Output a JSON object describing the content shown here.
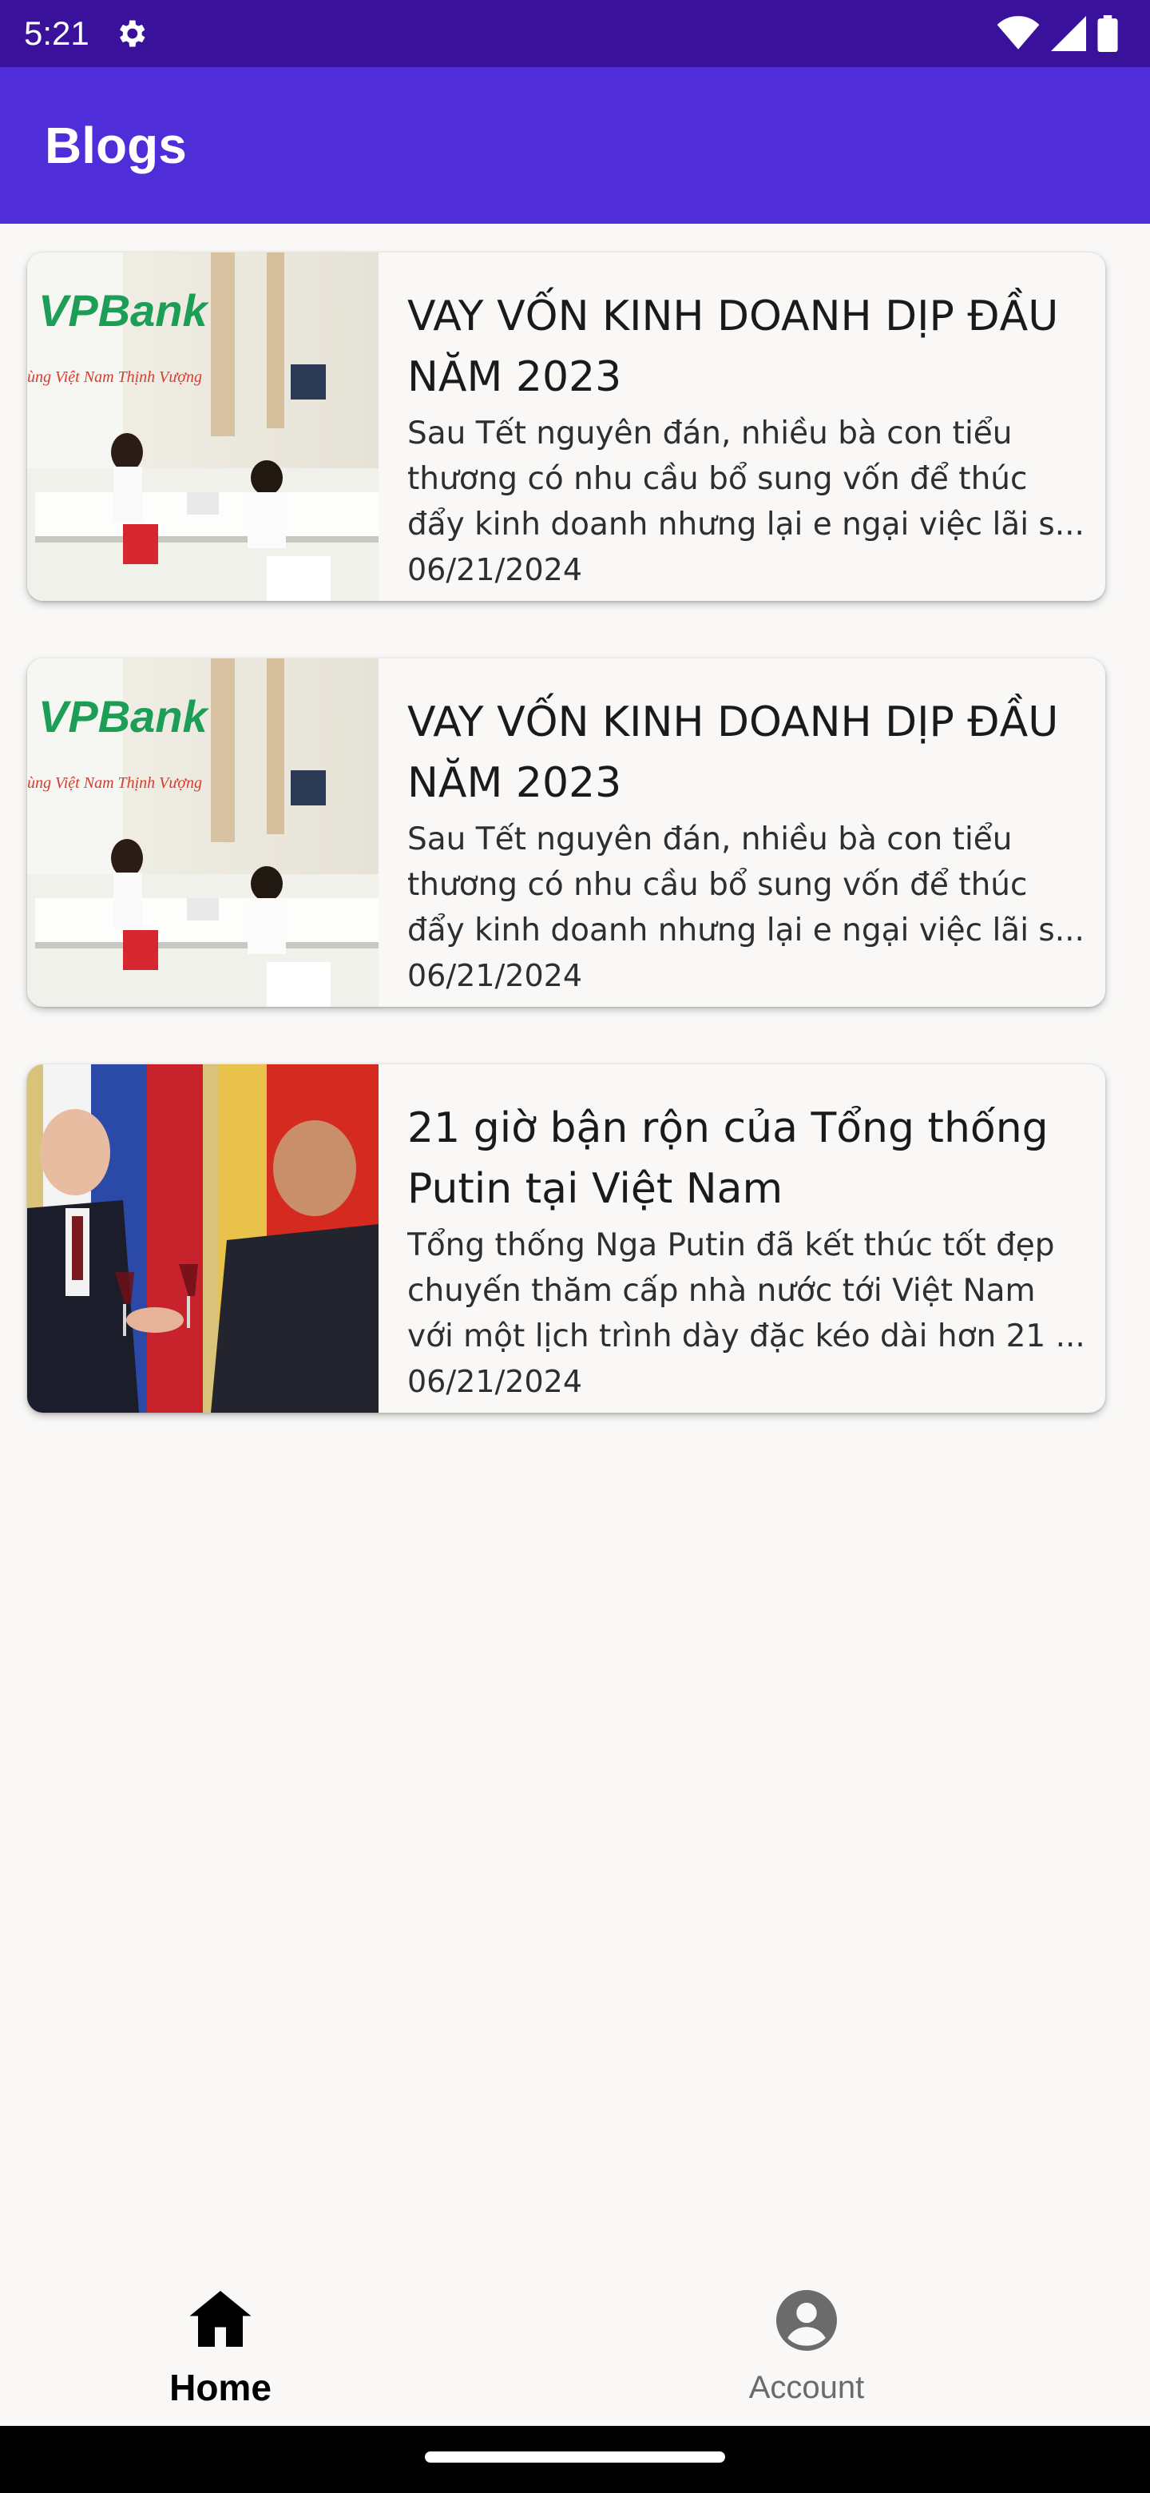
{
  "status_bar": {
    "time": "5:21",
    "icons": [
      "gear-icon",
      "wifi-icon",
      "signal-icon",
      "battery-icon"
    ]
  },
  "app_bar": {
    "title": "Blogs",
    "color": "#4f2dd9"
  },
  "blogs": [
    {
      "title": "VAY VỐN KINH DOANH DỊP ĐẦU NĂM 2023",
      "description": "Sau Tết nguyên đán, nhiều bà con tiểu thương có nhu cầu bổ sung vốn để thúc đẩy kinh doanh nhưng lại e ngại việc lãi s...",
      "date": "06/21/2024",
      "image": "vpbank-branch-photo"
    },
    {
      "title": "VAY VỐN KINH DOANH DỊP ĐẦU NĂM 2023",
      "description": "Sau Tết nguyên đán, nhiều bà con tiểu thương có nhu cầu bổ sung vốn để thúc đẩy kinh doanh nhưng lại e ngại việc lãi s...",
      "date": "06/21/2024",
      "image": "vpbank-branch-photo"
    },
    {
      "title": "21 giờ bận rộn của Tổng thống Putin tại Việt Nam",
      "description": "Tổng thống Nga Putin đã kết thúc tốt đẹp chuyến thăm cấp nhà nước tới Việt Nam với một lịch trình dày đặc kéo dài hơn 21 ...",
      "date": "06/21/2024",
      "image": "leaders-toast-photo"
    }
  ],
  "vpbank_logo_text": "VPBank",
  "vpbank_slogan": "ùng Việt Nam Thịnh Vượng",
  "bottom_nav": {
    "items": [
      {
        "label": "Home",
        "icon": "home-icon",
        "selected": true
      },
      {
        "label": "Account",
        "icon": "account-icon",
        "selected": false
      }
    ]
  }
}
